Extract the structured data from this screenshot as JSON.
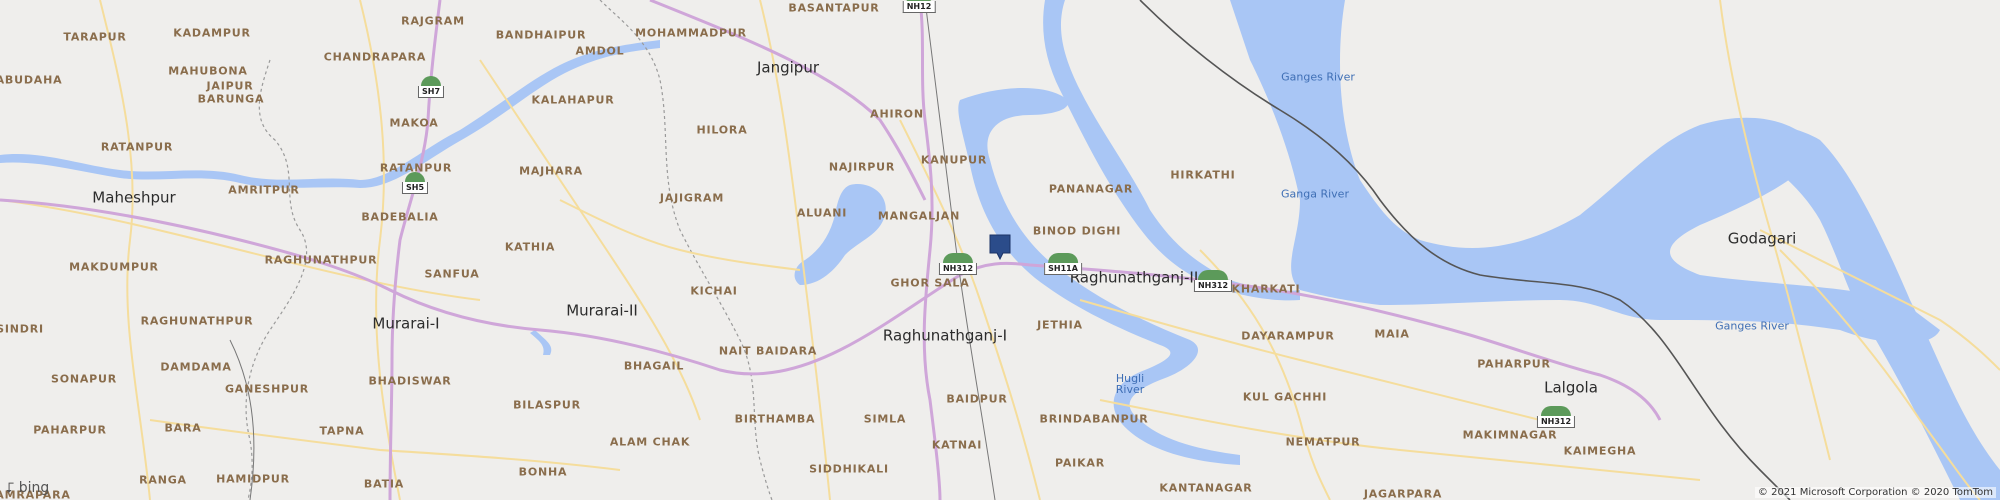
{
  "map": {
    "colors": {
      "land": "#efeeec",
      "water": "#a9c6f5",
      "highway": "#cfa6d9",
      "road": "#f5dd9c",
      "rail": "#555555",
      "border": "#9a9a9a"
    },
    "towns": [
      {
        "id": "jangipur",
        "name": "Jangipur"
      },
      {
        "id": "maheshpur",
        "name": "Maheshpur"
      },
      {
        "id": "murarai-1",
        "name": "Murarai-I"
      },
      {
        "id": "murarai-2",
        "name": "Murarai-II"
      },
      {
        "id": "raghunathganj-1",
        "name": "Raghunathganj-I"
      },
      {
        "id": "raghunathganj-2",
        "name": "Raghunathganj-II"
      },
      {
        "id": "godagari",
        "name": "Godagari"
      },
      {
        "id": "lalgola",
        "name": "Lalgola"
      }
    ],
    "villages": [
      "TARAPUR",
      "KADAMPUR",
      "RAJGRAM",
      "BANDHAIPUR",
      "MOHAMMADPUR",
      "BASANTAPUR",
      "AMDOL",
      "MAHUBONA",
      "CHANDRAPARA",
      "ABUDAHA",
      "JAIPUR",
      "BARUNGA",
      "KALAHAPUR",
      "MAKOA",
      "AHIRON",
      "HILORA",
      "RATANPUR",
      "RATANPUR",
      "MAJHARA",
      "NAJIRPUR",
      "KANUPUR",
      "AMRITPUR",
      "PANANAGAR",
      "HIRKATHI",
      "JAJIGRAM",
      "ALUANI",
      "MANGALJAN",
      "BADEBALIA",
      "BINOD DIGHI",
      "KATHIA",
      "RAGHUNATHPUR",
      "MAKDUMPUR",
      "SANFUA",
      "GHOR SALA",
      "KHARKATI",
      "KICHAI",
      "RAGHUNATHPUR",
      "JETHIA",
      "MAIA",
      "SINDRI",
      "DAYARAMPUR",
      "NAIT BAIDARA",
      "DAMDAMA",
      "BHAGAIL",
      "SONAPUR",
      "BHADISWAR",
      "PAHARPUR",
      "GANESHPUR",
      "BILASPUR",
      "BIRTHAMBA",
      "SIMLA",
      "BAIDPUR",
      "KUL GACHHI",
      "BARA",
      "TAPNA",
      "BRINDABANPUR",
      "MAKIMNAGAR",
      "PAHARPUR",
      "ALAM CHAK",
      "KATNAI",
      "NEMATPUR",
      "KAIMEGHA",
      "BONHA",
      "SIDDHIKALI",
      "PAIKAR",
      "HAMIDPUR",
      "RANGA",
      "BATIA",
      "KANTANAGAR",
      "JAGARPARA",
      "AMRAPARA"
    ],
    "rivers": [
      {
        "id": "ganges-river-1",
        "name": "Ganges River"
      },
      {
        "id": "ganga-river",
        "name": "Ganga River"
      },
      {
        "id": "ganges-river-2",
        "name": "Ganges River"
      },
      {
        "id": "hugli-river",
        "name": "Hugli\nRiver"
      }
    ],
    "shields": [
      "NH12",
      "SH7",
      "SH5",
      "NH312",
      "SH11A",
      "NH312",
      "NH312"
    ],
    "attribution": "© 2021 Microsoft Corporation © 2020 TomTom",
    "logo": "bing"
  }
}
